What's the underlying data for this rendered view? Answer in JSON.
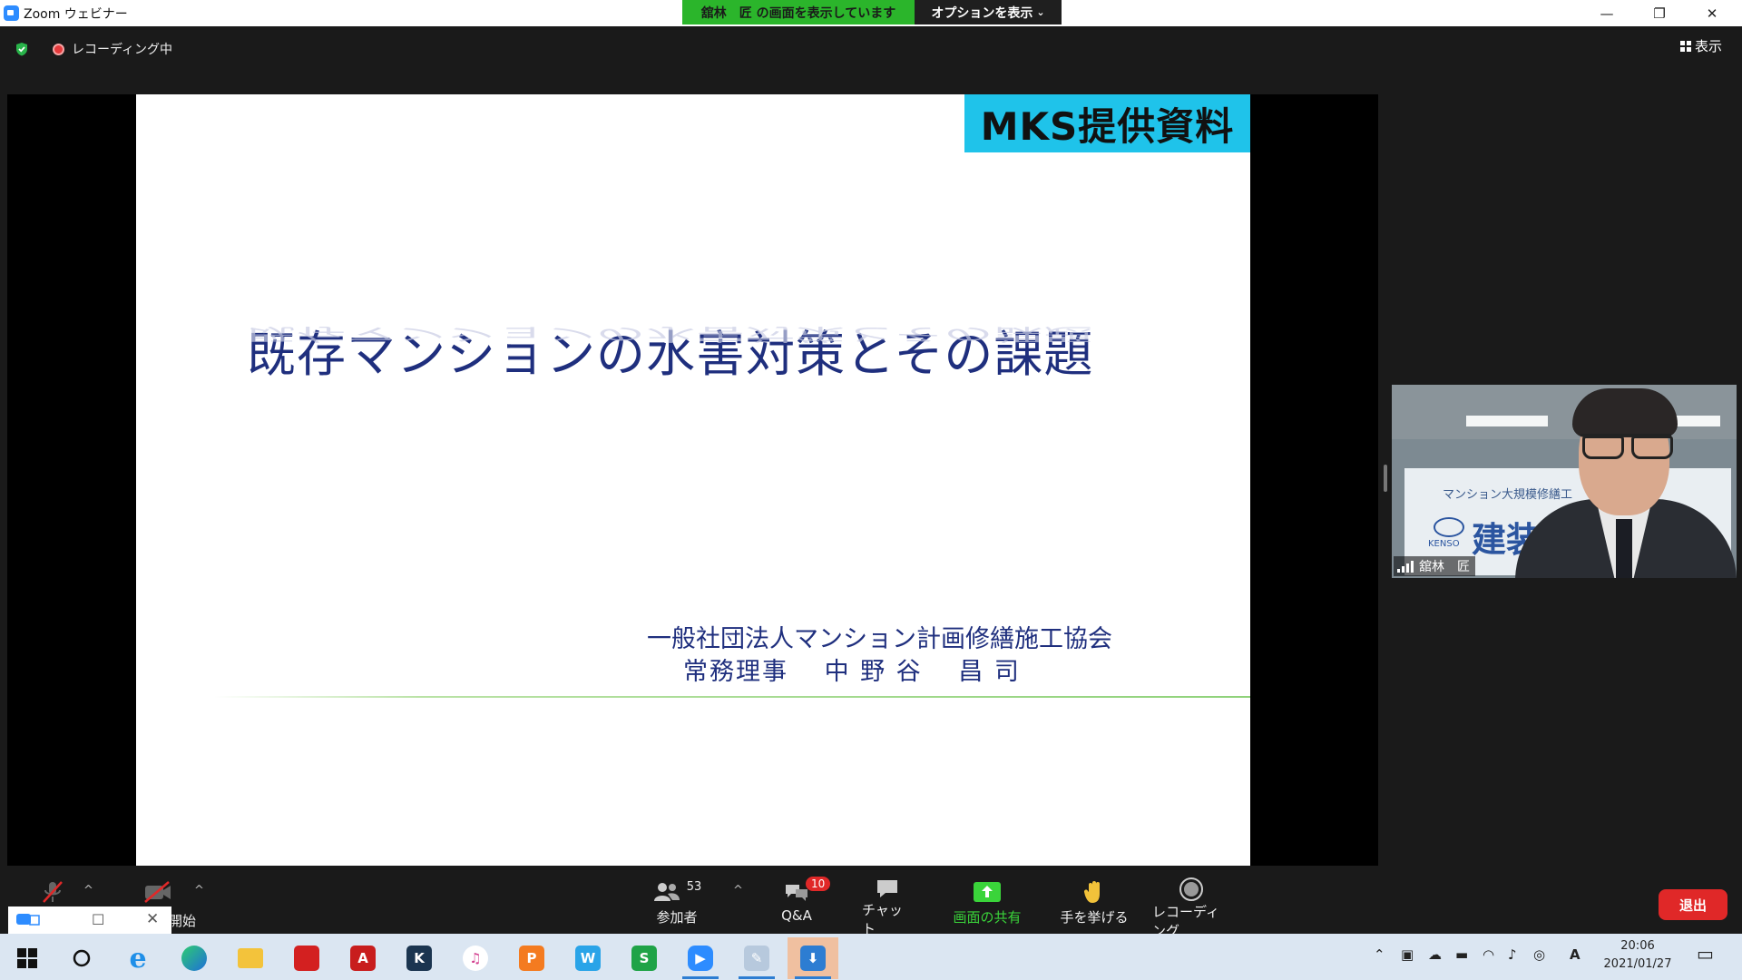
{
  "window": {
    "title": "Zoom ウェビナー",
    "minimize": "—",
    "restore": "❐",
    "close": "✕"
  },
  "share_banner": {
    "text": "舘林　匠 の画面を表示しています",
    "options_label": "オプションを表示"
  },
  "status": {
    "recording_label": "レコーディング中",
    "view_label": "表示"
  },
  "slide": {
    "badge": "MKS提供資料",
    "title": "既存マンションの水害対策とその課題",
    "organization": "一般社団法人マンション計画修繕施工協会",
    "presenter": "常務理事　 中 野 谷　 昌 司"
  },
  "video": {
    "participant_name": "舘林　匠",
    "background_sign_text": "マンション大規模修繕工",
    "background_logo_text": "KENSO",
    "background_kanji": "建装"
  },
  "toolbar": {
    "video_partial_label": "開始",
    "participants_count": "53",
    "participants_label": "参加者",
    "qa_badge": "10",
    "qa_label": "Q&A",
    "chat_label": "チャット",
    "share_label": "画面の共有",
    "raise_hand_label": "手を挙げる",
    "recording_label": "レコーディング",
    "leave_label": "退出"
  },
  "taskbar": {
    "time": "20:06",
    "date": "2021/01/27",
    "ime_indicator": "A"
  },
  "colors": {
    "accent_green": "#2bb52b",
    "leave_red": "#e02828",
    "slide_title": "#1f2f7e",
    "badge_blue": "#1fc3ea"
  }
}
